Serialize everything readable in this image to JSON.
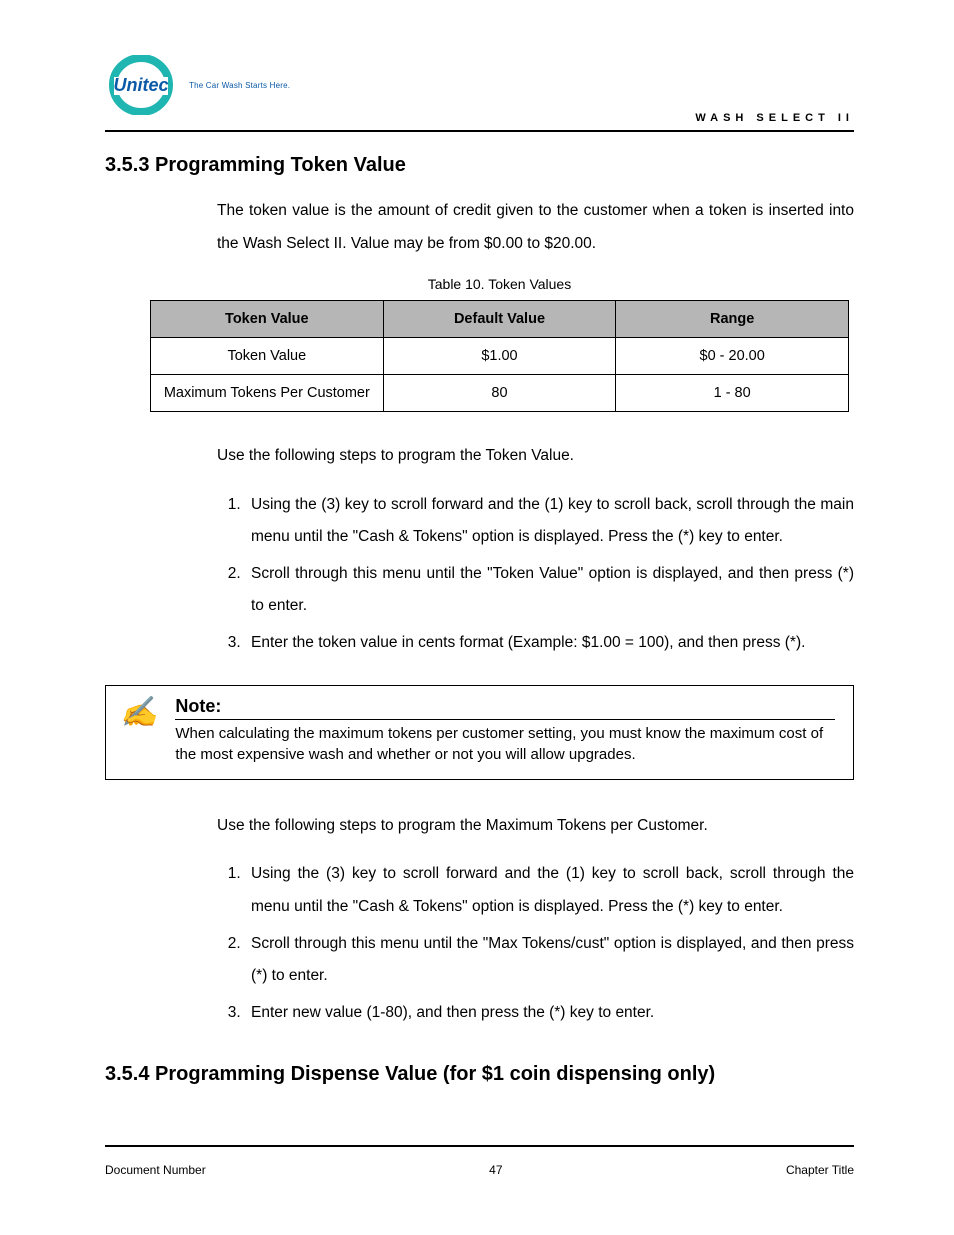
{
  "header": {
    "logo_text": "Unitec",
    "logo_tagline": "The Car Wash Starts Here.",
    "right_label": "WASH SELECT II"
  },
  "section_353": {
    "heading": "3.5.3 Programming Token Value",
    "intro": "The token value is the amount of credit given to the customer when a token is inserted into the Wash Select II. Value may be from $0.00 to $20.00.",
    "table_caption": "Table 10. Token Values",
    "table": {
      "headers": [
        "Token Value",
        "Default Value",
        "Range"
      ],
      "rows": [
        [
          "Token Value",
          "$1.00",
          "$0 - 20.00"
        ],
        [
          "Maximum Tokens Per Customer",
          "80",
          "1 - 80"
        ]
      ]
    },
    "para_after_table": "Use the following steps to program the Token Value.",
    "steps": [
      "Using the (3) key to scroll forward and the (1) key to scroll back, scroll through the main menu until the \"Cash & Tokens\" option is displayed. Press the (*) key to enter.",
      "Scroll through this menu until the \"Token Value\" option is displayed, and then press (*) to enter.",
      "Enter the token value in cents format (Example: $1.00 = 100), and then press (*)."
    ]
  },
  "note": {
    "label": "Note:",
    "body": "When calculating the maximum tokens per customer setting, you must know the maximum cost of the most expensive wash and whether or not you will allow upgrades."
  },
  "max_tokens": {
    "intro": "Use the following steps to program the Maximum Tokens per Customer.",
    "steps": [
      "Using the (3) key to scroll forward and the (1) key to scroll back, scroll through the menu until the \"Cash & Tokens\" option is displayed. Press the (*) key to enter.",
      "Scroll through this menu until the \"Max Tokens/cust\" option is displayed, and then press (*) to enter.",
      "Enter new value (1-80), and then press the (*) key to enter."
    ]
  },
  "section_354": {
    "heading": "3.5.4 Programming Dispense Value (for $1 coin dispensing only)"
  },
  "footer": {
    "left": "Document Number",
    "center": "47",
    "right": "Chapter Title"
  }
}
